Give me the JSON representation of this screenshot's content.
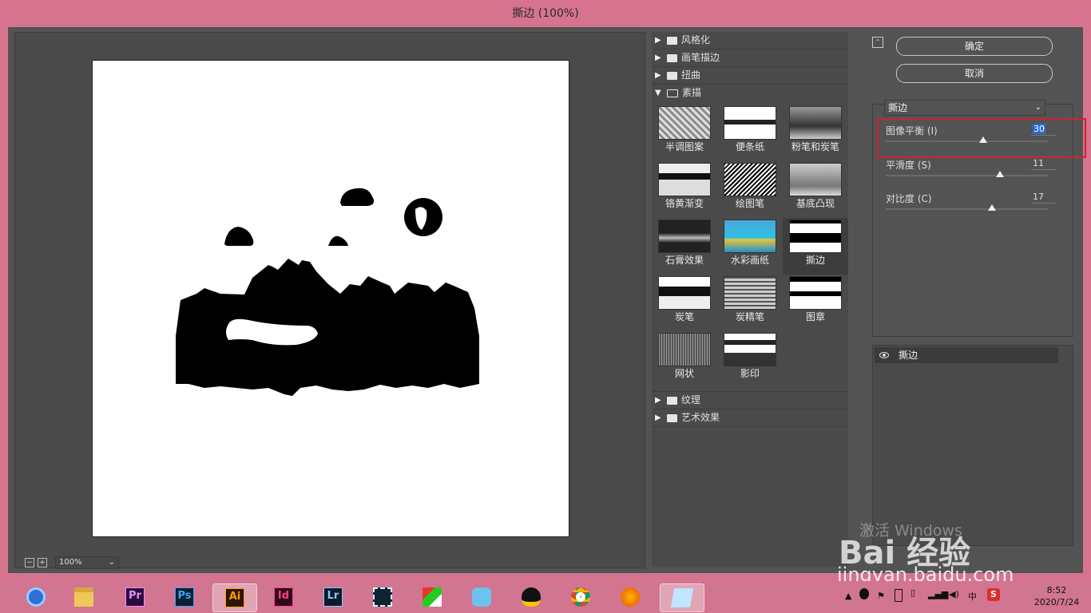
{
  "window": {
    "title": "撕边 (100%)"
  },
  "preview": {
    "zoom": "100%",
    "zoom_out": "−",
    "zoom_in": "+"
  },
  "gallery": {
    "collapsed_top": [
      "风格化",
      "画笔描边",
      "扭曲"
    ],
    "open_category": "素描",
    "filters": [
      "半调图案",
      "便条纸",
      "粉笔和炭笔",
      "铬黄渐变",
      "绘图笔",
      "基底凸现",
      "石膏效果",
      "水彩画纸",
      "撕边",
      "炭笔",
      "炭精笔",
      "图章",
      "网状",
      "影印"
    ],
    "selected": "撕边",
    "collapsed_bottom": [
      "纹理",
      "艺术效果"
    ]
  },
  "buttons": {
    "ok": "确定",
    "cancel": "取消"
  },
  "filter_select": "撕边",
  "params": [
    {
      "label": "图像平衡 (I)",
      "value": "30",
      "level": 0.6
    },
    {
      "label": "平滑度 (S)",
      "value": "11",
      "level": 0.7
    },
    {
      "label": "对比度 (C)",
      "value": "17",
      "level": 0.65
    }
  ],
  "layer": {
    "name": "撕边"
  },
  "taskbar": {
    "apps": [
      "browser-icon",
      "explorer-icon",
      "premiere-icon",
      "photoshop-icon",
      "illustrator-icon",
      "indesign-icon",
      "lightroom-icon",
      "video-icon",
      "paint-icon",
      "feishu-icon",
      "qq-icon",
      "chrome-icon",
      "firefox-icon",
      "notepad-icon"
    ],
    "labels": {
      "pr": "Pr",
      "ps": "Ps",
      "ai": "Ai",
      "id": "Id",
      "lr": "Lr"
    },
    "time": "8:52",
    "date": "2020/7/24",
    "ime": "中",
    "sogou": "S"
  },
  "watermark": {
    "activate": "激活 Windows",
    "logo": "Bai 经验",
    "url": "jingyan.baidu.com"
  }
}
